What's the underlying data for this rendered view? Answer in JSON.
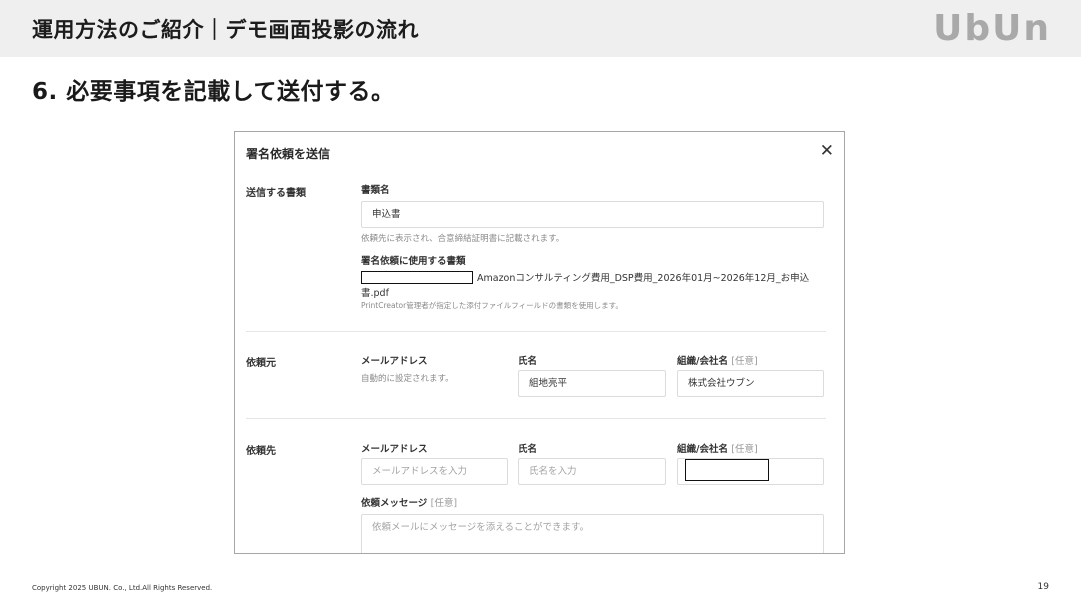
{
  "header": {
    "title": "運用方法のご紹介｜デモ画面投影の流れ",
    "logo": "UbUn"
  },
  "step": {
    "title": "6. 必要事項を記載して送付する。"
  },
  "dialog": {
    "title": "署名依頼を送信",
    "close_icon": "close-icon",
    "documents_section": {
      "label": "送信する書類",
      "doc_name_label": "書類名",
      "doc_name_value": "申込書",
      "doc_name_hint": "依頼先に表示され、合意締結証明書に記載されます。",
      "file_label": "署名依頼に使用する書類",
      "file_name": "Amazonコンサルティング費用_DSP費用_2026年01月~2026年12月_お申込書.pdf",
      "file_hint": "PrintCreator管理者が指定した添付ファイルフィールドの書類を使用します。"
    },
    "sender_section": {
      "label": "依頼元",
      "email_label": "メールアドレス",
      "email_hint": "自動的に設定されます。",
      "name_label": "氏名",
      "name_value": "組地亮平",
      "company_label": "組織/会社名",
      "company_optional": "[任意]",
      "company_value": "株式会社ウブン"
    },
    "recipient_section": {
      "label": "依頼先",
      "email_label": "メールアドレス",
      "email_placeholder": "メールアドレスを入力",
      "name_label": "氏名",
      "name_placeholder": "氏名を入力",
      "company_label": "組織/会社名",
      "company_optional": "[任意]",
      "message_label": "依頼メッセージ",
      "message_optional": "[任意]",
      "message_placeholder": "依頼メールにメッセージを添えることができます。"
    }
  },
  "footer": {
    "copyright": "Copyright 2025 UBUN. Co., Ltd.All Rights Reserved.",
    "page_number": "19"
  }
}
